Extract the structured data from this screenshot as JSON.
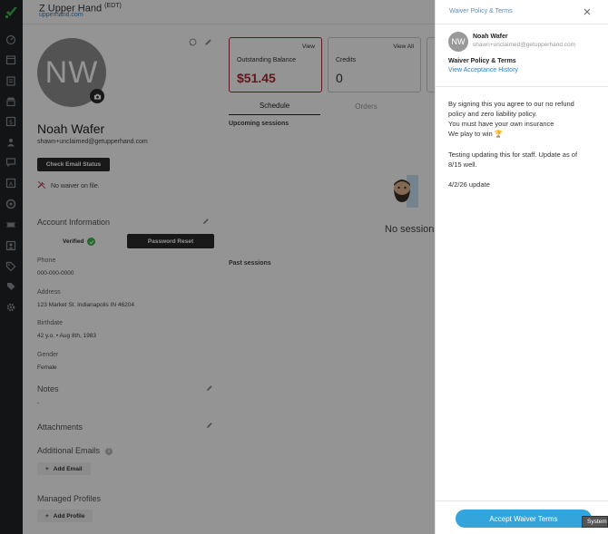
{
  "header": {
    "title": "Z Upper Hand",
    "timezone": "(EDT)",
    "subtitle": "upperhand.com"
  },
  "rail": {
    "icons": [
      "dashboard-icon",
      "calendar-icon",
      "clipboard-icon",
      "store-icon",
      "dollar-icon",
      "team-icon",
      "chat-icon",
      "reports-icon",
      "marketing-icon",
      "ticket-icon",
      "contacts-icon",
      "tag-icon",
      "coupon-icon",
      "settings-icon"
    ]
  },
  "profile": {
    "initials": "NW",
    "name": "Noah Wafer",
    "email": "shawn+unclaimed@getupperhand.com",
    "check_email_button": "Check Email Status",
    "waiver_status": "No waiver on file.",
    "account_info": {
      "title": "Account Information",
      "verified_label": "Verified",
      "password_reset_button": "Password Reset"
    },
    "fields": [
      {
        "label": "Phone",
        "value": "000-000-0000"
      },
      {
        "label": "Address",
        "value": "123 Market St. Indianapolis IN 46204"
      },
      {
        "label": "Birthdate",
        "value": "42 y.o. • Aug 8th, 1983"
      },
      {
        "label": "Gender",
        "value": "Female"
      }
    ],
    "notes": {
      "title": "Notes",
      "value": "-"
    },
    "attachments_title": "Attachments",
    "additional_emails": {
      "title": "Additional Emails",
      "info": "i",
      "add_button": "Add Email"
    },
    "managed_profiles": {
      "title": "Managed Profiles",
      "add_button": "Add Profile"
    }
  },
  "cards": [
    {
      "title": "Outstanding Balance",
      "link": "View",
      "value": "$51.45"
    },
    {
      "title": "Credits",
      "link": "View All",
      "value": "0"
    }
  ],
  "tabs": [
    "Schedule",
    "Orders"
  ],
  "sessions": {
    "upcoming_title": "Upcoming sessions",
    "empty_text": "No sessions",
    "past_title": "Past sessions"
  },
  "drawer": {
    "title": "Waiver Policy & Terms",
    "client_initials": "NW",
    "client_name": "Noah Wafer",
    "client_email": "shawn+unclaimed@getupperhand.com",
    "policy_heading": "Waiver Policy & Terms",
    "history_link": "View Acceptance History",
    "body_lines": [
      "By signing this you agree to our no refund",
      "policy and zero liability policy.",
      "You must have your own insurance",
      "We play to win 🏆"
    ],
    "body_lines_2": [
      "Testing updating this for staff. Update as of",
      "8/15 well."
    ],
    "body_line_3": "4/2/26 update",
    "accept_button": "Accept Waiver Terms"
  },
  "tooltip": "System",
  "colors": {
    "accent_red": "#a8272f",
    "link_blue": "#2a82c9",
    "button_blue": "#33a5dc",
    "verified_green": "#3bb54a"
  }
}
